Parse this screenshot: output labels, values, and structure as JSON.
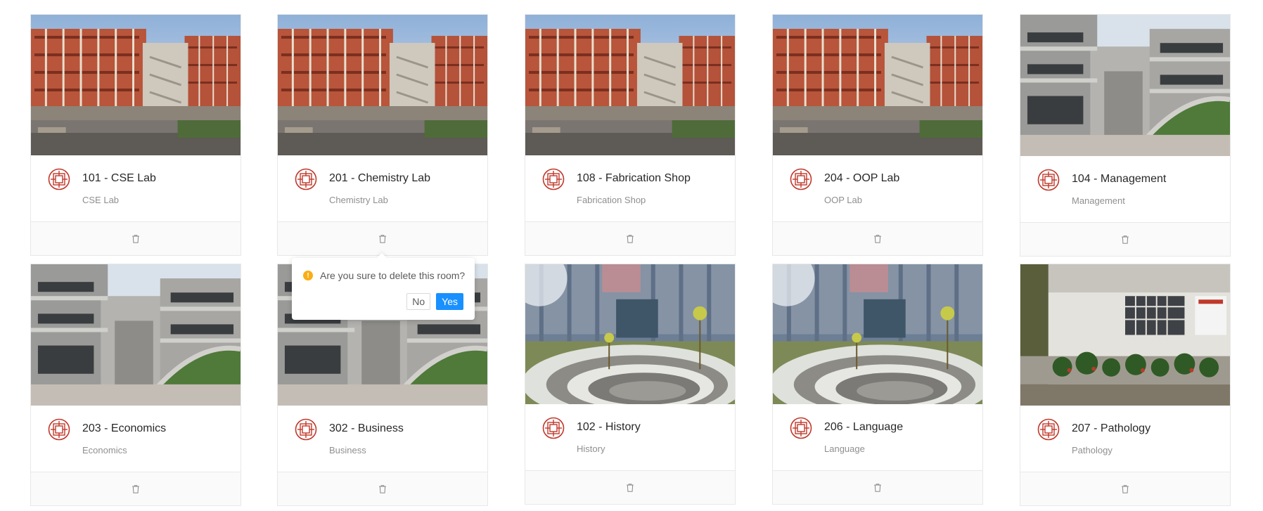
{
  "rooms": [
    {
      "title": "101 - CSE Lab",
      "description": "CSE Lab",
      "image": "brick-building"
    },
    {
      "title": "201 - Chemistry Lab",
      "description": "Chemistry Lab",
      "image": "brick-building"
    },
    {
      "title": "108 - Fabrication Shop",
      "description": "Fabrication Shop",
      "image": "brick-building"
    },
    {
      "title": "204 - OOP Lab",
      "description": "OOP Lab",
      "image": "brick-building"
    },
    {
      "title": "104 - Management",
      "description": "Management",
      "image": "concrete-courtyard"
    },
    {
      "title": "203 - Economics",
      "description": "Economics",
      "image": "concrete-courtyard"
    },
    {
      "title": "302 - Business",
      "description": "Business",
      "image": "concrete-courtyard"
    },
    {
      "title": "102 - History",
      "description": "History",
      "image": "amphitheatre"
    },
    {
      "title": "206 - Language",
      "description": "Language",
      "image": "amphitheatre"
    },
    {
      "title": "207 - Pathology",
      "description": "Pathology",
      "image": "building-with-plants"
    }
  ],
  "popconfirm": {
    "message": "Are you sure to delete this room?",
    "cancel_label": "No",
    "confirm_label": "Yes",
    "icon": "exclamation-circle-icon"
  },
  "colors": {
    "primary": "#1890ff",
    "warning": "#faad14",
    "logo": "#c0392b",
    "border": "#e8e8e8",
    "actions_bg": "#fafafa"
  },
  "icons": {
    "avatar": "university-logo-icon",
    "delete": "trash-icon"
  }
}
